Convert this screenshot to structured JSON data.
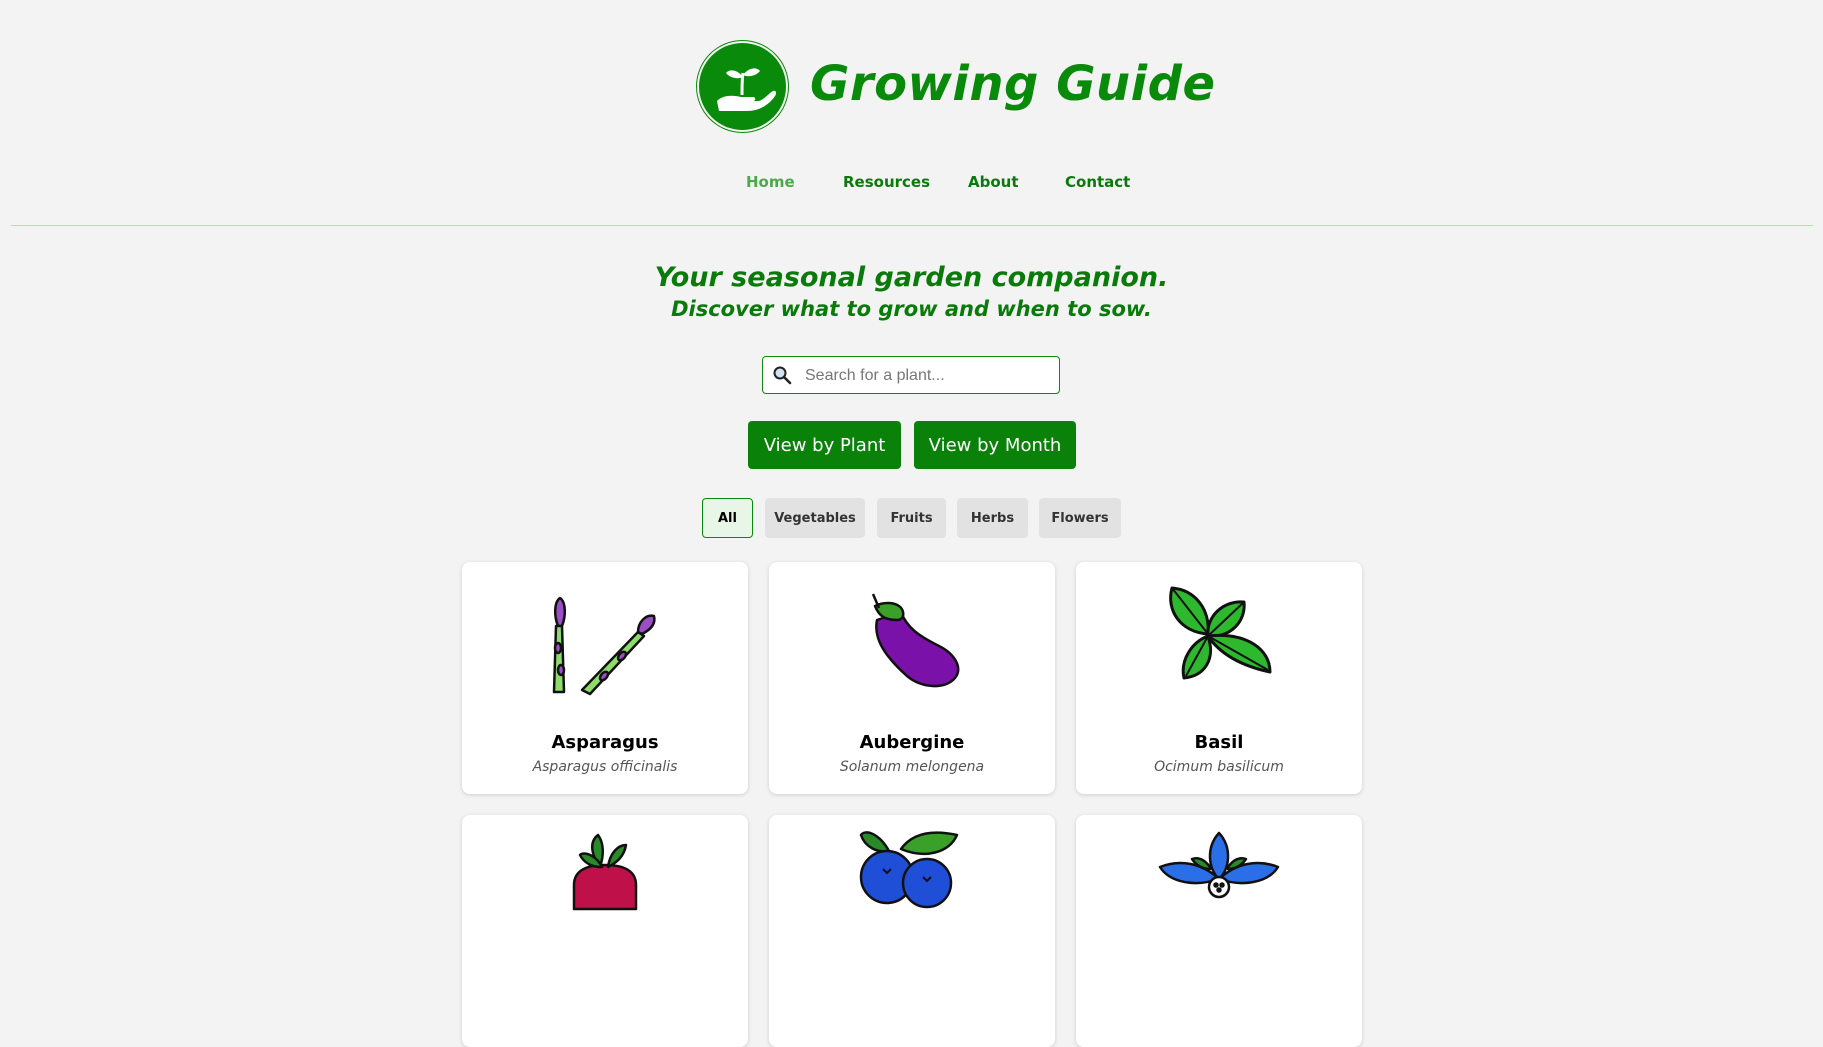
{
  "site": {
    "title": "Growing Guide"
  },
  "nav": {
    "items": [
      {
        "label": "Home"
      },
      {
        "label": "Resources"
      },
      {
        "label": "About"
      },
      {
        "label": "Contact"
      }
    ]
  },
  "hero": {
    "tagline": "Your seasonal garden companion.",
    "subtagline": "Discover what to grow and when to sow."
  },
  "search": {
    "placeholder": "Search for a plant...",
    "value": ""
  },
  "view_buttons": {
    "by_plant": "View by Plant",
    "by_month": "View by Month"
  },
  "filters": {
    "items": [
      {
        "label": "All",
        "active": true
      },
      {
        "label": "Vegetables"
      },
      {
        "label": "Fruits"
      },
      {
        "label": "Herbs"
      },
      {
        "label": "Flowers"
      }
    ]
  },
  "plants": [
    {
      "name": "Asparagus",
      "latin": "Asparagus officinalis",
      "icon": "asparagus-icon"
    },
    {
      "name": "Aubergine",
      "latin": "Solanum melongena",
      "icon": "aubergine-icon"
    },
    {
      "name": "Basil",
      "latin": "Ocimum basilicum",
      "icon": "basil-icon"
    },
    {
      "name": "",
      "latin": "",
      "icon": "beetroot-icon"
    },
    {
      "name": "",
      "latin": "",
      "icon": "blueberry-icon"
    },
    {
      "name": "",
      "latin": "",
      "icon": "borage-flower-icon"
    }
  ],
  "colors": {
    "brand": "#0a8a0a",
    "nav_active": "#4aaa4a",
    "background": "#f3f3f3"
  }
}
